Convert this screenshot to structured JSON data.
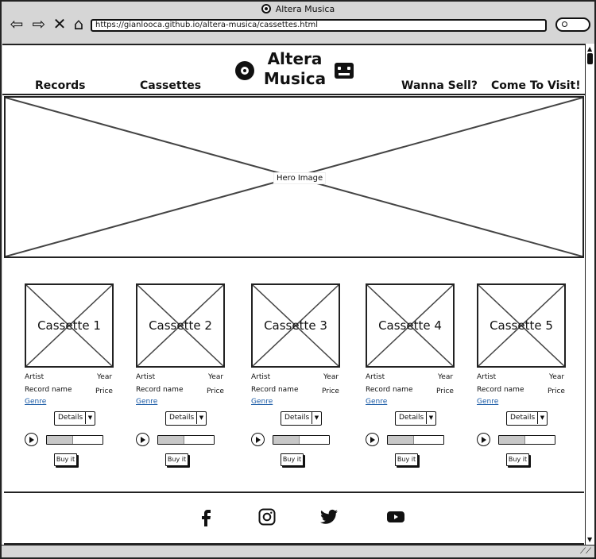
{
  "browser": {
    "title": "Altera Musica",
    "url": "https://gianlooca.github.io/altera-musica/cassettes.html"
  },
  "header": {
    "logo_line1": "Altera",
    "logo_line2": "Musica",
    "nav": [
      "Records",
      "Cassettes",
      "Wanna Sell?",
      "Come To Visit!"
    ]
  },
  "hero": {
    "label": "Hero Image"
  },
  "products": [
    {
      "title": "Cassette 1",
      "artist": "Artist",
      "year": "Year",
      "record": "Record name",
      "price": "Price",
      "genre": "Genre",
      "details": "Details",
      "buy": "Buy it",
      "progress": 0.47
    },
    {
      "title": "Cassette 2",
      "artist": "Artist",
      "year": "Year",
      "record": "Record name",
      "price": "Price",
      "genre": "Genre",
      "details": "Details",
      "buy": "Buy it",
      "progress": 0.47
    },
    {
      "title": "Cassette 3",
      "artist": "Artist",
      "year": "Year",
      "record": "Record name",
      "price": "Price",
      "genre": "Genre",
      "details": "Details",
      "buy": "Buy it",
      "progress": 0.47
    },
    {
      "title": "Cassette 4",
      "artist": "Artist",
      "year": "Year",
      "record": "Record name",
      "price": "Price",
      "genre": "Genre",
      "details": "Details",
      "buy": "Buy it",
      "progress": 0.47
    },
    {
      "title": "Cassette 5",
      "artist": "Artist",
      "year": "Year",
      "record": "Record name",
      "price": "Price",
      "genre": "Genre",
      "details": "Details",
      "buy": "Buy it",
      "progress": 0.47
    }
  ],
  "footer": {
    "icons": [
      "facebook-icon",
      "instagram-icon",
      "twitter-icon",
      "youtube-icon"
    ]
  },
  "colors": {
    "link": "#1a5aa5",
    "frame": "#d6d6d6",
    "ink": "#111111"
  }
}
